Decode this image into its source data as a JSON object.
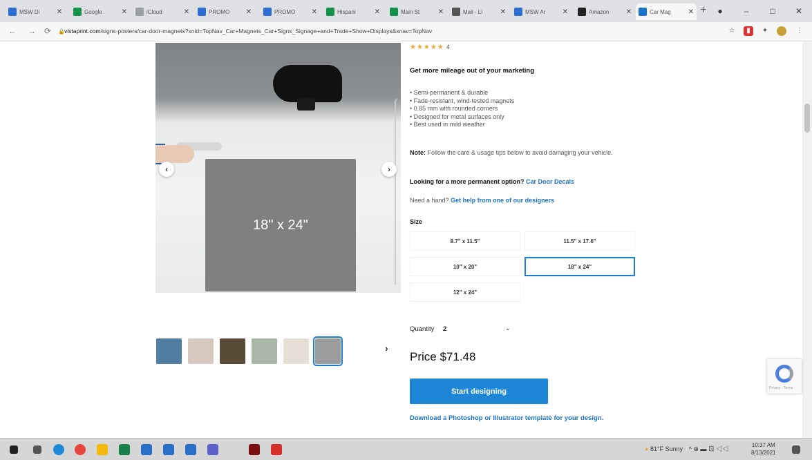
{
  "browser": {
    "tabs": [
      {
        "title": "MSW Di",
        "color": "#2d6ed6",
        "left": 0
      },
      {
        "title": "Google",
        "color": "#14914a",
        "left": 0
      },
      {
        "title": "iCloud",
        "color": "#9aa0a6",
        "left": 0
      },
      {
        "title": "PROMO",
        "color": "#2d6ed6",
        "left": 0
      },
      {
        "title": "PROMO",
        "color": "#2d6ed6",
        "left": 0
      },
      {
        "title": "Hispani",
        "color": "#14914a",
        "left": 0
      },
      {
        "title": "Main St",
        "color": "#14914a",
        "left": 0
      },
      {
        "title": "Mail - Li",
        "color": "#555555",
        "left": 0
      },
      {
        "title": "MSW Ar",
        "color": "#2d6ed6",
        "left": 0
      },
      {
        "title": "Amazon",
        "color": "#222222",
        "left": 0
      },
      {
        "title": "Car Mag",
        "color": "#1a73c9",
        "left": 0
      }
    ],
    "url_host": "vistaprint.com",
    "url_path": "/signs-posters/car-door-magnets?xnid=TopNav_Car+Magnets_Car+Signs_Signage+and+Trade+Show+Displays&xnav=TopNav"
  },
  "gallery": {
    "magnet_label": "18\" x 24\"",
    "prev_symbol": "‹",
    "next_symbol": "›",
    "thumbs_next_symbol": "›",
    "thumb_colors": [
      "#4f7ea0",
      "#d7c9c0",
      "#5a4a38",
      "#a9b7a6",
      "#e6dfd6",
      "#9a9c9e"
    ],
    "selected_thumb_index": 5
  },
  "product": {
    "stars": "★★★★★",
    "rating_count": "4",
    "headline": "Get more mileage out of your marketing",
    "bullets": [
      "• Semi-permanent & durable",
      "• Fade-resistant, wind-tested magnets",
      "• 0.85 mm with rounded corners",
      "• Designed for metal surfaces only",
      "• Best used in mild weather"
    ],
    "note_label": "Note:",
    "note_text": "Follow the care & usage tips below to avoid damaging your vehicle.",
    "permanent_q": "Looking for a more permanent option?",
    "permanent_link": "Car Door Decals",
    "help_q": "Need a hand?",
    "help_link": "Get help from one of our designers",
    "size_label": "Size",
    "sizes": [
      "8.7\" x 11.5\"",
      "11.5\" x 17.6\"",
      "10\" x 20\"",
      "18\" x 24\"",
      "12\" x 24\""
    ],
    "selected_size_index": 3,
    "quantity_label": "Quantity",
    "quantity_value": "2",
    "quantity_dropdown": "⌄",
    "price": "Price $71.48",
    "cta": "Start designing",
    "download_link": "Download a Photoshop or Illustrator template for your design."
  },
  "recaptcha": {
    "footer": "Privacy - Terms"
  },
  "taskbar": {
    "weather": "81°F Sunny",
    "tray_icons": "^ ⊕ ▬ ㄖ ◁◁",
    "time": "10:37 AM",
    "date": "8/13/2021"
  }
}
